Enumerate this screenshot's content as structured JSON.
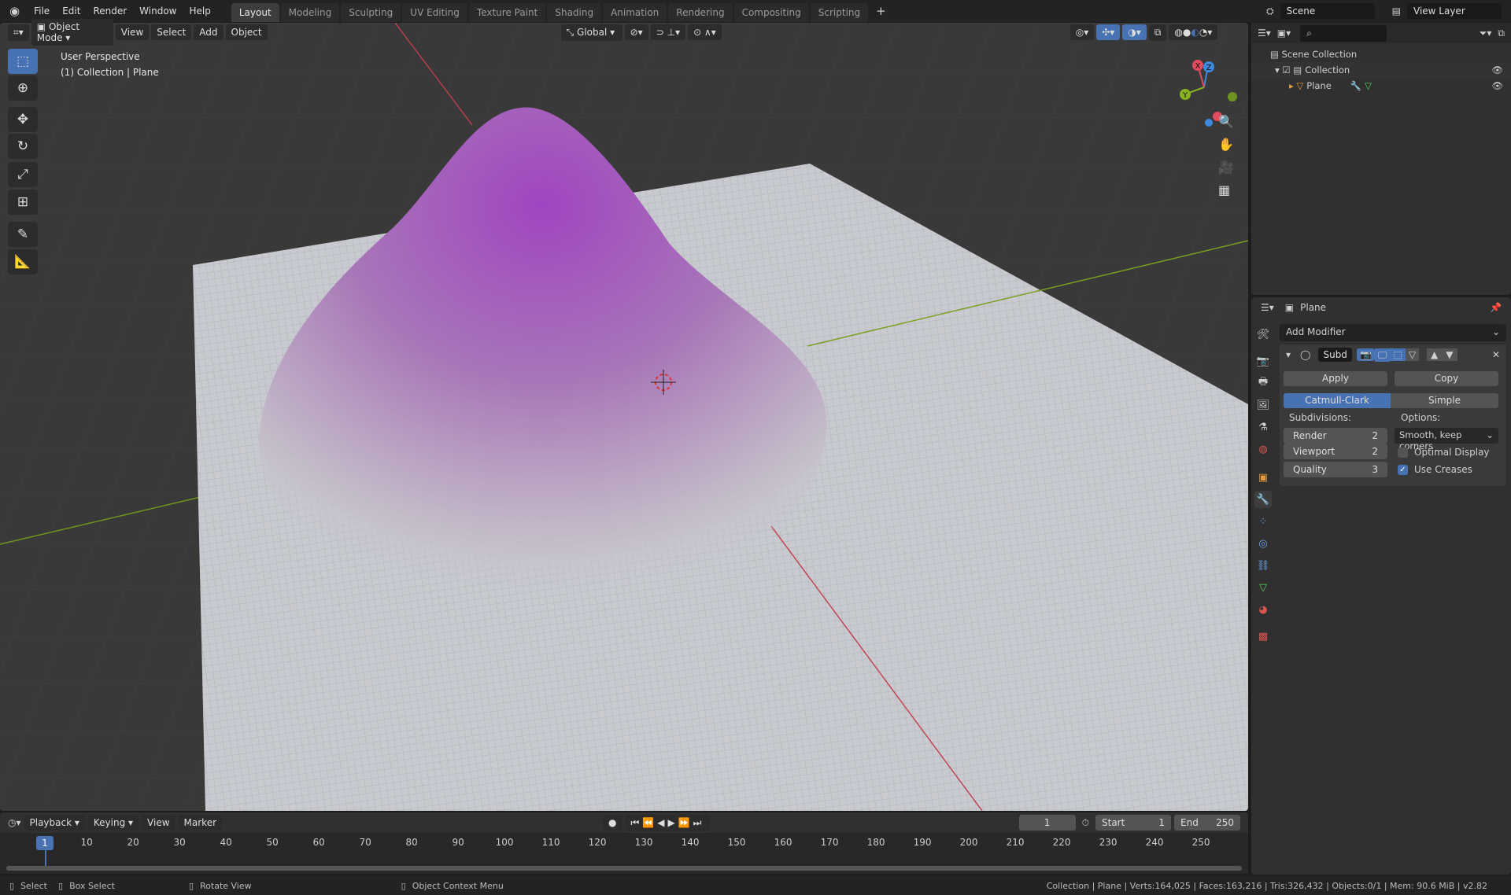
{
  "topbar": {
    "menus": [
      "File",
      "Edit",
      "Render",
      "Window",
      "Help"
    ],
    "workspaces": [
      "Layout",
      "Modeling",
      "Sculpting",
      "UV Editing",
      "Texture Paint",
      "Shading",
      "Animation",
      "Rendering",
      "Compositing",
      "Scripting"
    ],
    "add_tab": "+",
    "scene": "Scene",
    "view_layer": "View Layer"
  },
  "viewport": {
    "mode": "Object Mode",
    "menus": [
      "View",
      "Select",
      "Add",
      "Object"
    ],
    "orientation": "Global",
    "overlay_title": "User Perspective",
    "overlay_subtitle": "(1) Collection | Plane",
    "gizmo": {
      "x": "X",
      "y": "Y",
      "z": "Z"
    }
  },
  "outliner": {
    "root": "Scene Collection",
    "collection": "Collection",
    "object": "Plane"
  },
  "properties": {
    "object": "Plane",
    "add_modifier": "Add Modifier",
    "modifier_name": "Subd",
    "apply": "Apply",
    "copy": "Copy",
    "type_options": [
      "Catmull-Clark",
      "Simple"
    ],
    "selected_type": "Catmull-Clark",
    "subdivisions_label": "Subdivisions:",
    "options_label": "Options:",
    "render_label": "Render",
    "render_value": "2",
    "viewport_label": "Viewport",
    "viewport_value": "2",
    "quality_label": "Quality",
    "quality_value": "3",
    "uv_smooth": "Smooth, keep corners",
    "optimal_display": "Optimal Display",
    "optimal_display_checked": false,
    "use_creases": "Use Creases",
    "use_creases_checked": true
  },
  "timeline": {
    "menus": [
      "Playback",
      "Keying",
      "View",
      "Marker"
    ],
    "current_frame": "1",
    "start_label": "Start",
    "start": "1",
    "end_label": "End",
    "end": "250",
    "ticks": [
      "10",
      "20",
      "30",
      "40",
      "50",
      "60",
      "70",
      "80",
      "90",
      "100",
      "110",
      "120",
      "130",
      "140",
      "150",
      "160",
      "170",
      "180",
      "190",
      "200",
      "210",
      "220",
      "230",
      "240",
      "250"
    ]
  },
  "statusbar": {
    "select": "Select",
    "box_select": "Box Select",
    "rotate_view": "Rotate View",
    "context_menu": "Object Context Menu",
    "stats": "Collection | Plane | Verts:164,025 | Faces:163,216 | Tris:326,432 | Objects:0/1 | Mem: 90.6 MiB | v2.82"
  },
  "colors": {
    "accent": "#4772b3",
    "x_axis": "#e34a5b",
    "y_axis": "#86b31f",
    "z_axis": "#3e8ae0",
    "mesh_peak": "#a045c0"
  }
}
